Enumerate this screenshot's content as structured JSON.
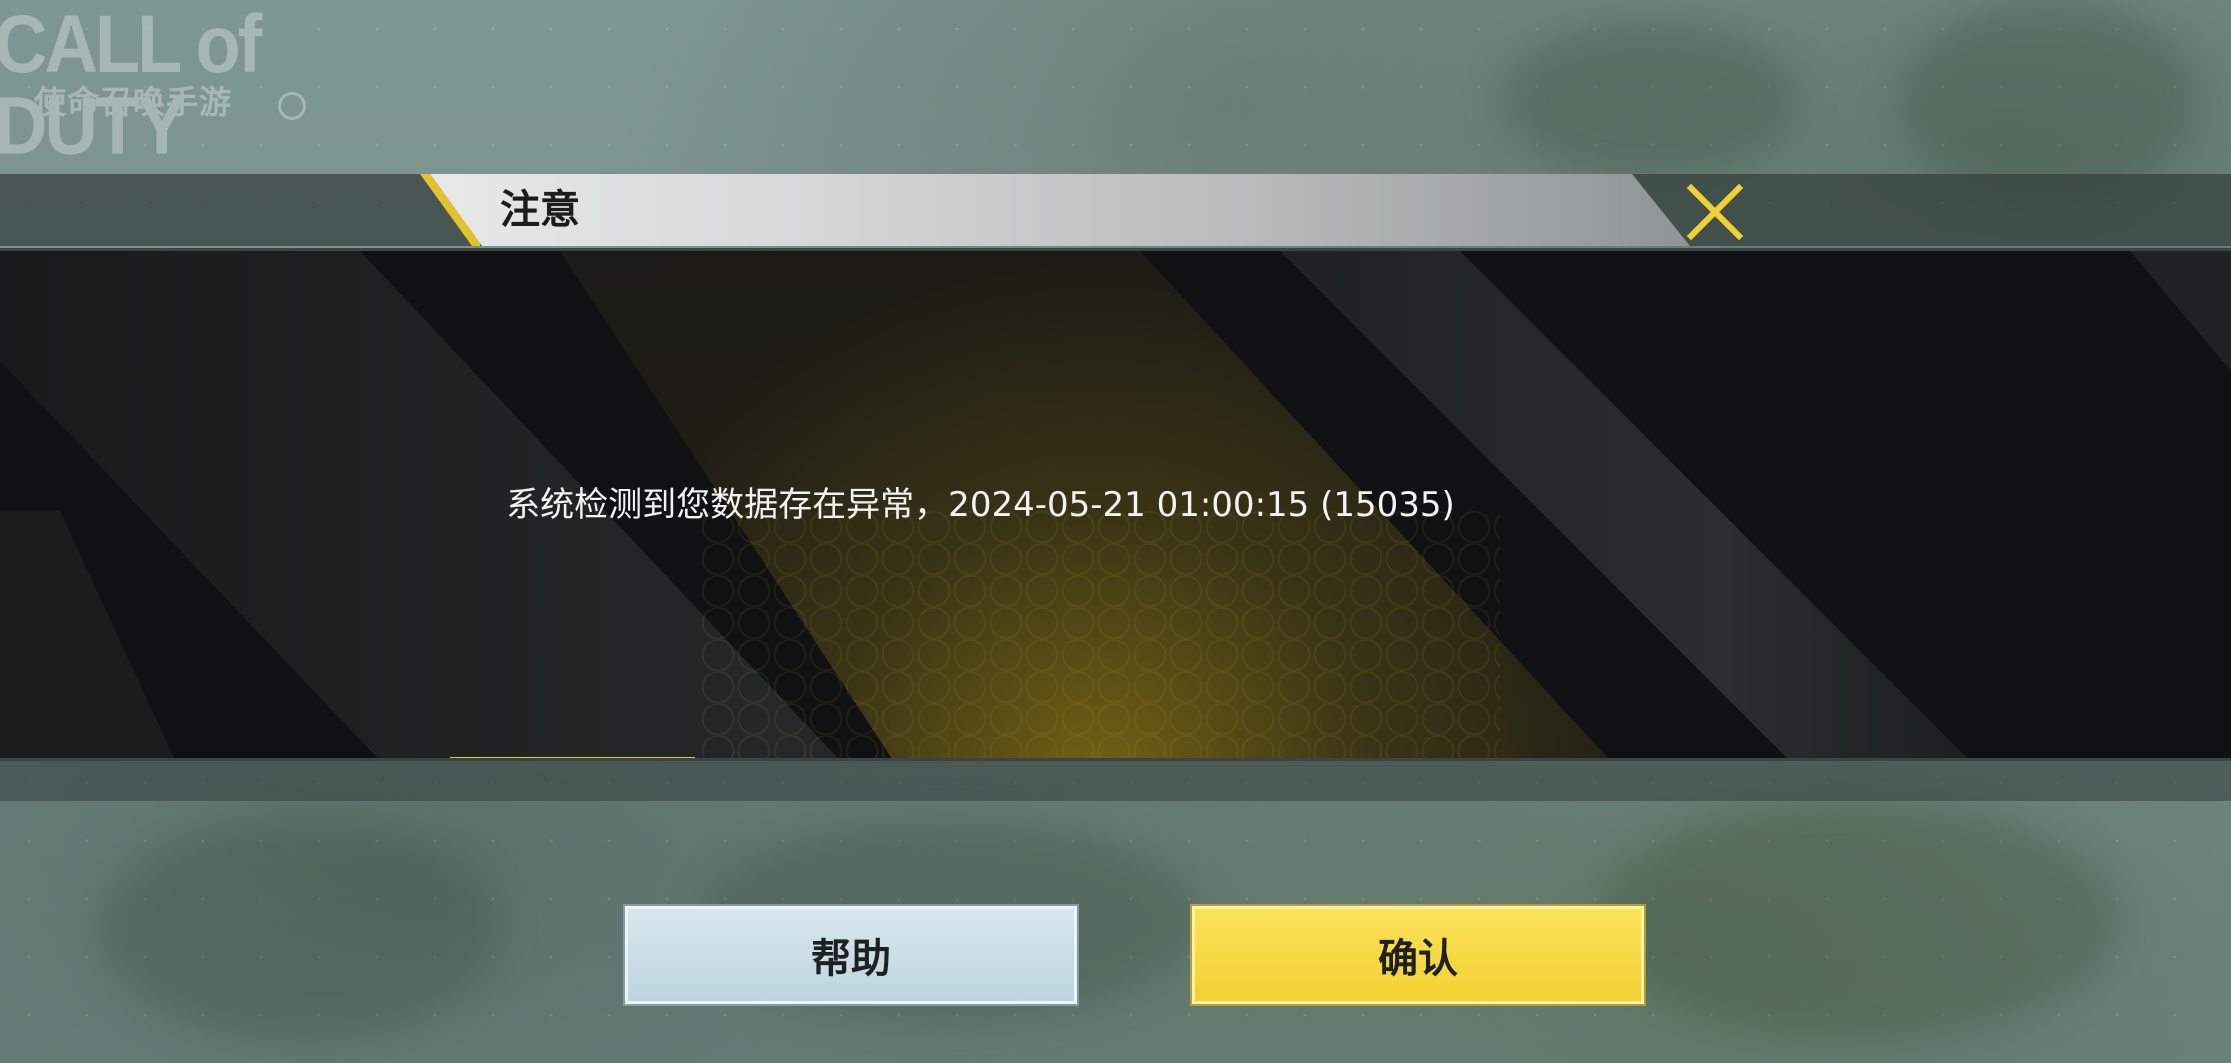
{
  "logo": {
    "main": "CALL of DUTY",
    "sub": "使命召唤手游"
  },
  "dialog": {
    "title": "注意",
    "message": "系统检测到您数据存在异常，2024-05-21 01:00:15 (15035)",
    "close_icon": "close-x-icon"
  },
  "buttons": {
    "help_label": "帮助",
    "confirm_label": "确认"
  },
  "colors": {
    "accent_yellow": "#e2c22b",
    "confirm_button": "#f6d63c",
    "help_button": "#c9dde6",
    "panel_bg": "#101112"
  }
}
